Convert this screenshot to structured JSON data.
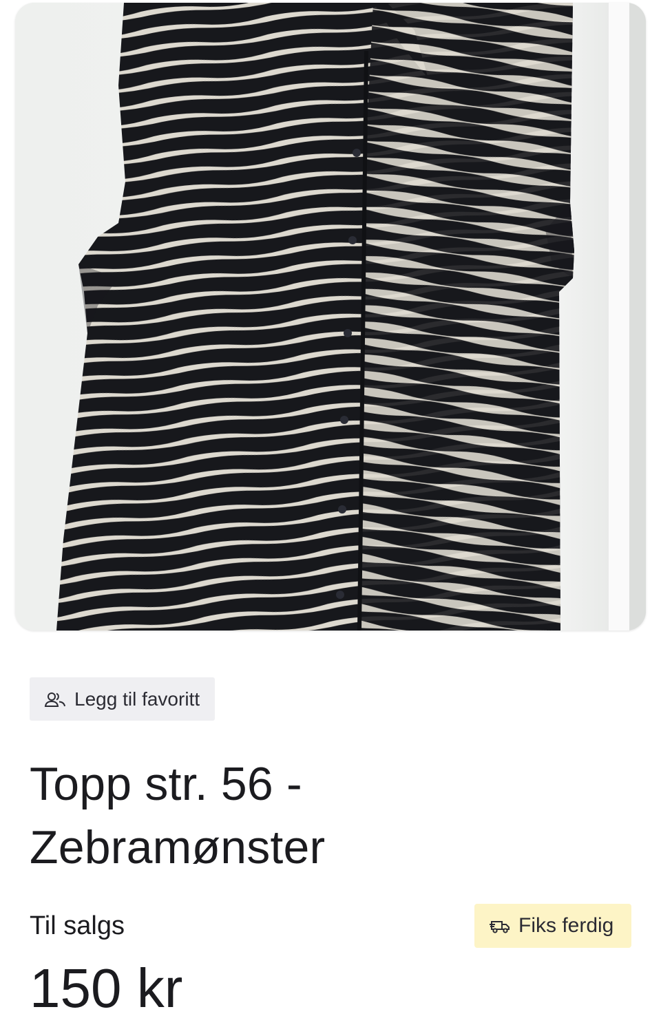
{
  "listing": {
    "image": {
      "alt": "Zebramønster topp",
      "icon": "product-photo",
      "colors": {
        "background": "#f1f2f1",
        "fabric_dark": "#17181c",
        "fabric_light": "#ddd9cf"
      }
    },
    "favorite_button": {
      "label": "Legg til favoritt",
      "icon": "users-icon"
    },
    "title": "Topp str. 56  -\nZebramønster",
    "status_label": "Til salgs",
    "price": "150 kr",
    "shipping_badge": {
      "label": "Fiks ferdig",
      "icon": "delivery-truck-icon",
      "color": "#fdf4c6"
    }
  }
}
